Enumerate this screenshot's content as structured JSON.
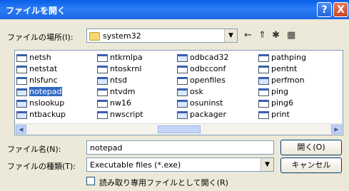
{
  "title": "ファイルを開く",
  "titlebar": {
    "help_label": "?",
    "close_label": "X"
  },
  "lookin": {
    "label": "ファイルの場所(I):",
    "value": "system32"
  },
  "toolbar": {
    "back_icon": "←",
    "up_icon": "⇑",
    "newfolder_icon": "✱",
    "view_icon": "▦"
  },
  "files": {
    "col1": [
      "netsh",
      "netstat",
      "nlsfunc",
      "notepad",
      "nslookup",
      "ntbackup"
    ],
    "col2": [
      "ntkrnlpa",
      "ntoskrnl",
      "ntsd",
      "ntvdm",
      "nw16",
      "nwscript"
    ],
    "col3": [
      "odbcad32",
      "odbcconf",
      "openfiles",
      "osk",
      "osuninst",
      "packager"
    ],
    "col4": [
      "pathping",
      "pentnt",
      "perfmon",
      "ping",
      "ping6",
      "print"
    ],
    "selected": "notepad"
  },
  "filename": {
    "label": "ファイル名(N):",
    "value": "notepad"
  },
  "filetype": {
    "label": "ファイルの種類(T):",
    "value": "Executable files (*.exe)"
  },
  "buttons": {
    "open": "開く(O)",
    "cancel": "キャンセル"
  },
  "readonly": {
    "label": "読み取り専用ファイルとして開く(R)"
  }
}
